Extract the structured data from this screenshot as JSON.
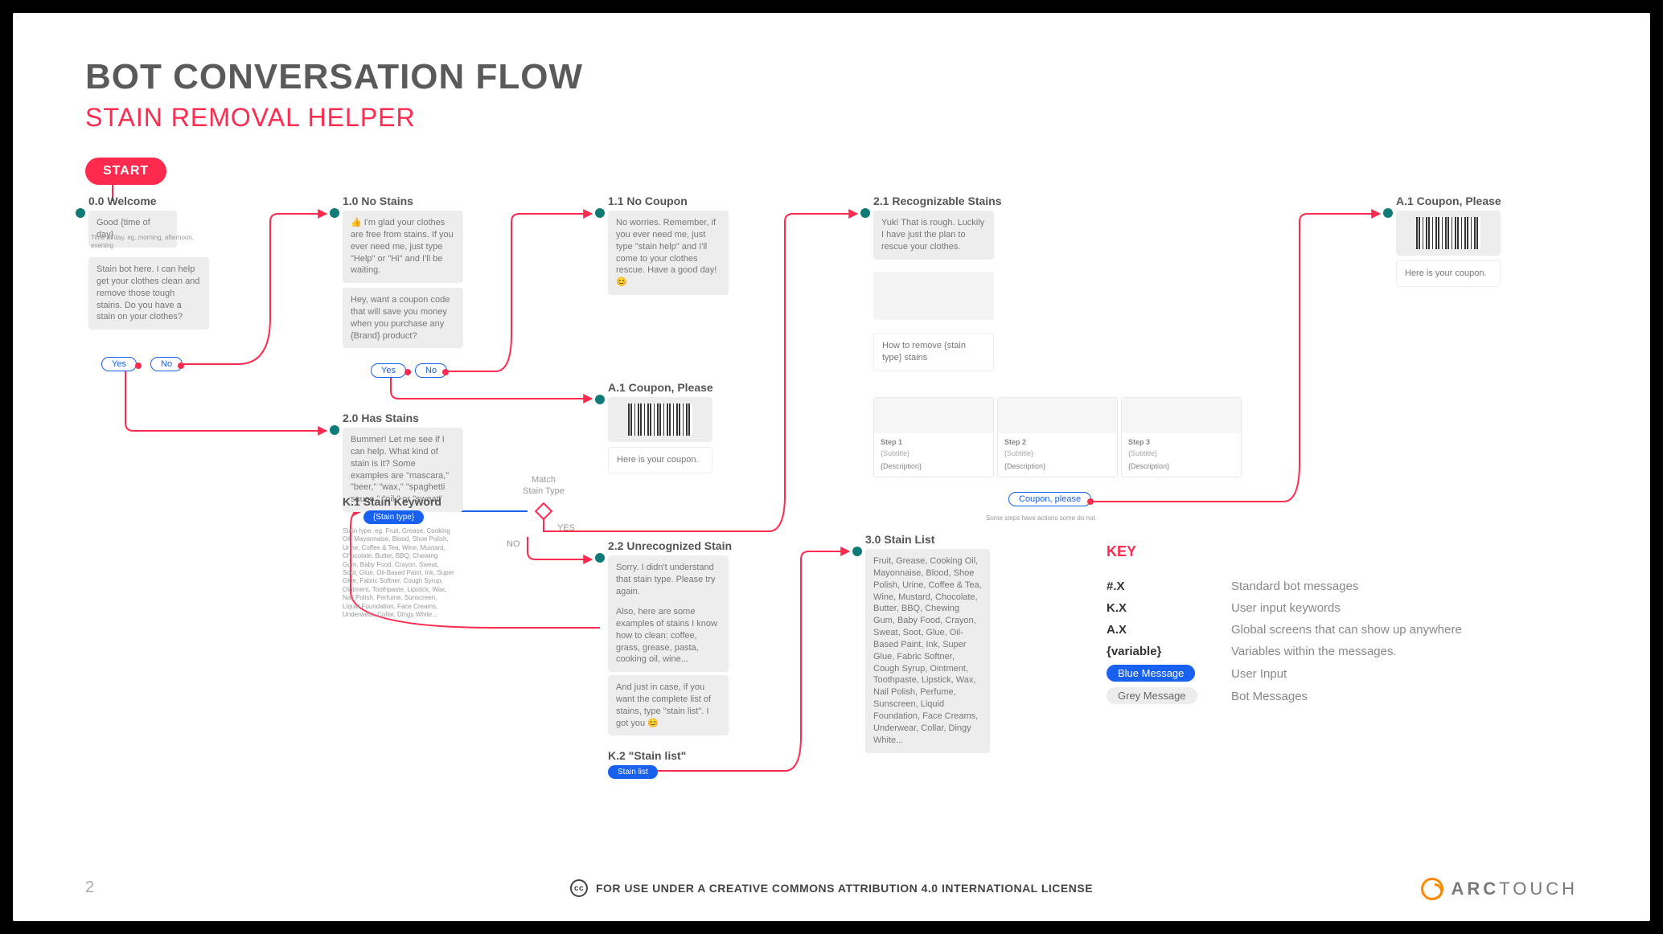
{
  "titles": {
    "main": "BOT CONVERSATION FLOW",
    "sub": "STAIN REMOVAL HELPER",
    "start": "START"
  },
  "nodes": {
    "n00": {
      "label": "0.0 Welcome",
      "msg1": "Good {time of day}",
      "note": "Time of day. eg. morning, afternoon, evening",
      "msg2": "Stain bot here. I can help get your clothes clean and remove those tough stains. Do you have a stain on your clothes?",
      "yes": "Yes",
      "no": "No"
    },
    "n10": {
      "label": "1.0 No Stains",
      "msg1": "👍 I'm glad your clothes are free from stains. If you ever need me, just type \"Help\" or \"Hi\" and I'll be waiting.",
      "msg2": "Hey, want a coupon code that will save you money when you purchase any {Brand} product?",
      "yes": "Yes",
      "no": "No"
    },
    "n11": {
      "label": "1.1 No Coupon",
      "msg": "No worries. Remember, if you ever need me, just type \"stain help\" and I'll come to your clothes rescue. Have a good day! 😊"
    },
    "a1": {
      "label": "A.1 Coupon, Please",
      "msg": "Here is your coupon."
    },
    "a1b": {
      "label": "A.1 Coupon, Please",
      "msg": "Here is your coupon."
    },
    "n20": {
      "label": "2.0 Has Stains",
      "msg": "Bummer! Let me see if I can help. What  kind of stain is it? Some examples are \"mascara,\" \"beer,\" \"wax,\" \"spaghetti sauce,\" \"oil,\"  or \"sweat\""
    },
    "k1": {
      "label": "K.1 Stain Keyword",
      "pill": "{Stain type}",
      "note": "Stain type. eg. Fruit, Grease, Cooking Oil, Mayonnaise, Blood, Shoe Polish, Urine, Coffee & Tea, Wine, Mustard, Chocolate, Butter, BBQ, Chewing Gum, Baby Food, Crayon, Sweat, Soot, Glue, Oil-Based Paint, Ink, Super Glue, Fabric Softner,  Cough Syrup, Ointment, Toothpaste, Lipstick, Wax, Nail Polish, Perfume, Sunscreen, Liquid Foundation, Face Creams, Underwear, Collar, Dingy White..."
    },
    "match": {
      "title": "Match\nStain Type",
      "yes": "YES",
      "no": "NO"
    },
    "n21": {
      "label": "2.1 Recognizable Stains",
      "msg1": "Yuk! That is rough. Luckily I have just the plan to rescue your clothes.",
      "msg2": "How to remove {stain type} stains",
      "steps": [
        {
          "t": "Step 1",
          "s": "{Subtitle}",
          "d": "{Description}"
        },
        {
          "t": "Step 2",
          "s": "{Subtitle}",
          "d": "{Description}"
        },
        {
          "t": "Step 3",
          "s": "{Subtitle}",
          "d": "{Description}"
        }
      ],
      "coupon": "Coupon, please",
      "note": "Some steps have actions some do not."
    },
    "n22": {
      "label": "2.2 Unrecognized Stain",
      "msg1": "Sorry. I didn't understand that stain type. Please try again.",
      "msg2": "Also, here are some examples of stains I know how to clean: coffee, grass, grease, pasta, cooking oil, wine...",
      "msg3": "And just in case, if you want the complete list of stains, type \"stain list\". I got you 😊"
    },
    "k2": {
      "label": "K.2 \"Stain list\"",
      "pill": "Stain list"
    },
    "n30": {
      "label": "3.0 Stain List",
      "msg": "Fruit, Grease, Cooking Oil, Mayonnaise, Blood, Shoe Polish, Urine, Coffee & Tea, Wine, Mustard, Chocolate, Butter, BBQ, Chewing Gum, Baby Food, Crayon, Sweat, Soot, Glue,  Oil-Based Paint, Ink, Super Glue, Fabric Softner,  Cough Syrup, Ointment, Toothpaste, Lipstick, Wax, Nail Polish, Perfume, Sunscreen, Liquid Foundation, Face Creams, Underwear, Collar, Dingy White..."
    }
  },
  "key": {
    "title": "KEY",
    "rows": [
      {
        "code": "#.X",
        "desc": "Standard bot messages"
      },
      {
        "code": "K.X",
        "desc": "User input keywords"
      },
      {
        "code": "A.X",
        "desc": "Global screens that can show up anywhere"
      },
      {
        "code": "{variable}",
        "desc": "Variables within the messages."
      }
    ],
    "blue": "Blue Message",
    "blue_desc": "User Input",
    "grey": "Grey Message",
    "grey_desc": "Bot Messages"
  },
  "footer": {
    "page": "2",
    "license": "FOR USE UNDER A CREATIVE COMMONS ATTRIBUTION 4.0 INTERNATIONAL LICENSE",
    "brand": "ARC",
    "brand2": "TOUCH"
  }
}
